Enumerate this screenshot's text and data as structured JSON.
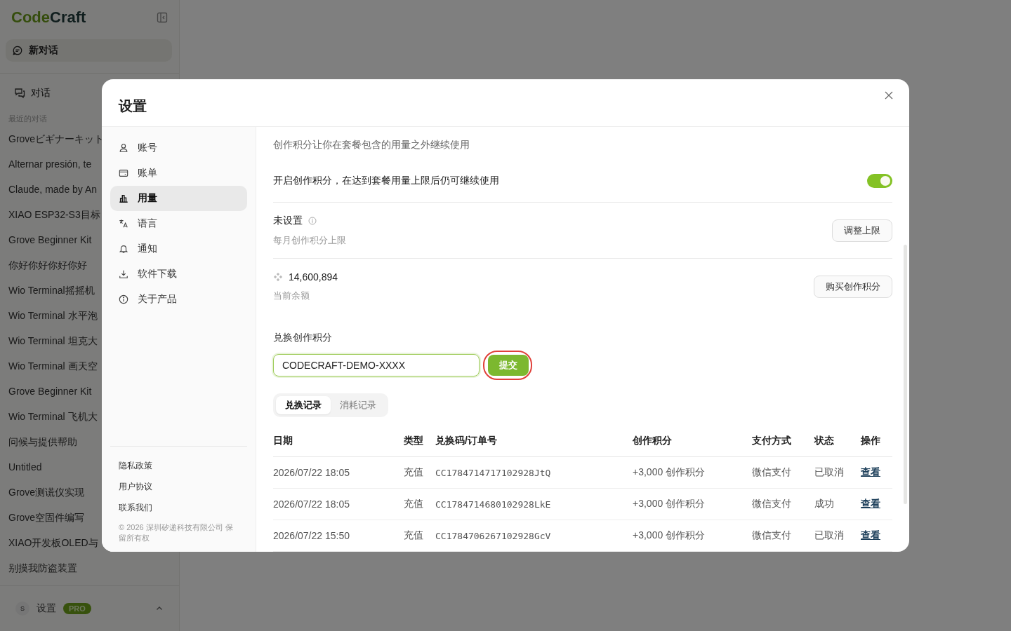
{
  "app": {
    "logo_first": "Code",
    "logo_second": "Craft",
    "new_chat": "新对话",
    "chats_link": "对话",
    "recent_heading": "最近的对话",
    "recent": [
      "Groveビギナーキット",
      "Alternar presión, te",
      "Claude, made by An",
      "XIAO ESP32-S3目标",
      "Grove Beginner Kit",
      "你好你好你好你好",
      "Wio Terminal摇摇机",
      "Wio Terminal 水平泡",
      "Wio Terminal 坦克大",
      "Wio Terminal 画天空",
      "Grove Beginner Kit",
      "Wio Terminal 飞机大",
      "问候与提供帮助",
      "Untitled",
      "Grove测谎仪实现",
      "Grove空固件编写",
      "XIAO开发板OLED与",
      "别摸我防盗装置"
    ],
    "user": {
      "avatar": "S",
      "label": "设置",
      "badge": "PRO"
    }
  },
  "dialog": {
    "title": "设置",
    "nav": [
      {
        "label": "账号",
        "selected": false
      },
      {
        "label": "账单",
        "selected": false
      },
      {
        "label": "用量",
        "selected": true
      },
      {
        "label": "语言",
        "selected": false
      },
      {
        "label": "通知",
        "selected": false
      },
      {
        "label": "软件下载",
        "selected": false
      },
      {
        "label": "关于产品",
        "selected": false
      }
    ],
    "footer_links": [
      "隐私政策",
      "用户协议",
      "联系我们"
    ],
    "copyright": "© 2026 深圳矽递科技有限公司 保留所有权",
    "intro": "创作积分让你在套餐包含的用量之外继续使用",
    "toggle": {
      "label": "开启创作积分，在达到套餐用量上限后仍可继续使用",
      "on": true
    },
    "limit": {
      "value": "未设置",
      "caption": "每月创作积分上限",
      "button": "调整上限"
    },
    "balance": {
      "value": "14,600,894",
      "caption": "当前余额",
      "button": "购买创作积分"
    },
    "redeem": {
      "title": "兑换创作积分",
      "value": "CODECRAFT-DEMO-XXXX",
      "button": "提交",
      "highlighted": true
    },
    "tabs": [
      {
        "label": "兑换记录",
        "selected": true
      },
      {
        "label": "消耗记录",
        "selected": false
      }
    ],
    "table": {
      "columns": [
        "日期",
        "类型",
        "兑换码/订单号",
        "创作积分",
        "支付方式",
        "状态",
        "操作"
      ],
      "rows": [
        {
          "date": "2026/07/22 18:05",
          "type": "充值",
          "code": "CC1784714717102928JtQ",
          "credits": "+3,000 创作积分",
          "payment": "微信支付",
          "status": "已取消",
          "action": "查看"
        },
        {
          "date": "2026/07/22 18:05",
          "type": "充值",
          "code": "CC1784714680102928LkE",
          "credits": "+3,000 创作积分",
          "payment": "微信支付",
          "status": "成功",
          "action": "查看"
        },
        {
          "date": "2026/07/22 15:50",
          "type": "充值",
          "code": "CC1784706267102928GcV",
          "credits": "+3,000 创作积分",
          "payment": "微信支付",
          "status": "已取消",
          "action": "查看"
        }
      ]
    }
  }
}
